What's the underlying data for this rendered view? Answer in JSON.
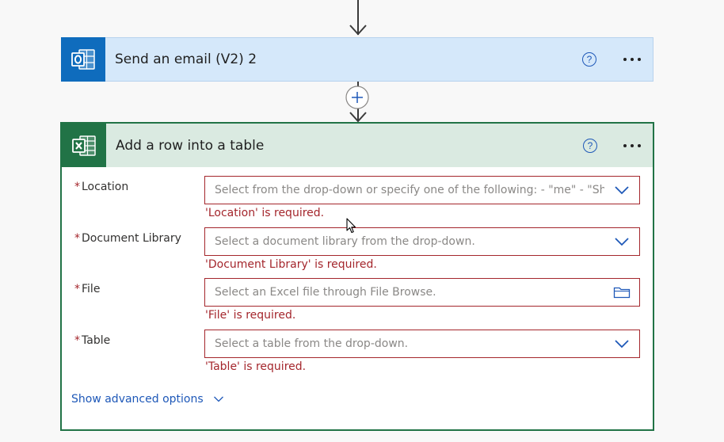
{
  "email_card": {
    "title": "Send an email (V2) 2",
    "help": "?",
    "icon": "outlook-icon",
    "color": "#d5e8fa"
  },
  "excel_card": {
    "title": "Add a row into a table",
    "help": "?",
    "icon": "excel-icon",
    "color": "#daeae1",
    "accent": "#217346",
    "required_mark": "*",
    "fields": [
      {
        "label": "Location",
        "placeholder": "Select from the drop-down or specify one of the following: - \"me\" - \"SharePoint Site URL\"",
        "error": "'Location' is required.",
        "trailing_icon": "chevron-down-icon"
      },
      {
        "label": "Document Library",
        "placeholder": "Select a document library from the drop-down.",
        "error": "'Document Library' is required.",
        "trailing_icon": "chevron-down-icon"
      },
      {
        "label": "File",
        "placeholder": "Select an Excel file through File Browse.",
        "error": "'File' is required.",
        "trailing_icon": "folder-icon"
      },
      {
        "label": "Table",
        "placeholder": "Select a table from the drop-down.",
        "error": "'Table' is required.",
        "trailing_icon": "chevron-down-icon"
      }
    ],
    "advanced_label": "Show advanced options"
  },
  "colors": {
    "error": "#a4262c",
    "link": "#1e58b8",
    "outlook_blue": "#0f6cbd"
  }
}
